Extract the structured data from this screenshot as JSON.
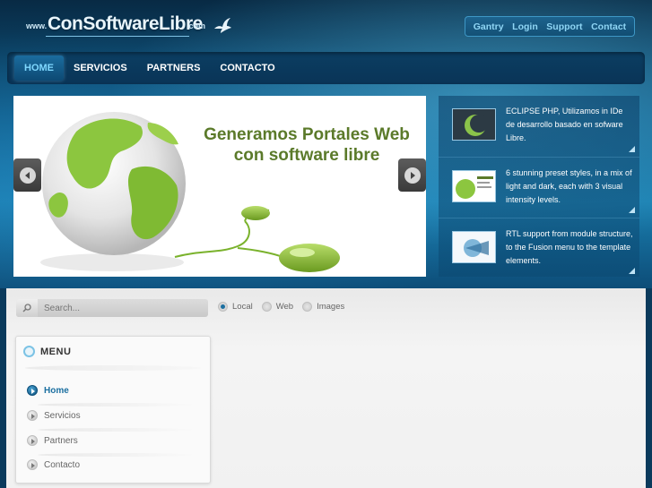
{
  "header": {
    "logo": {
      "prefix": "www.",
      "name": "ConSoftwareLibre",
      "suffix": ".com"
    },
    "top_links": [
      "Gantry",
      "Login",
      "Support",
      "Contact"
    ]
  },
  "main_nav": [
    {
      "label": "HOME",
      "active": true
    },
    {
      "label": "SERVICIOS",
      "active": false
    },
    {
      "label": "PARTNERS",
      "active": false
    },
    {
      "label": "CONTACTO",
      "active": false
    }
  ],
  "slider": {
    "headline_line1": "Generamos Portales Web",
    "headline_line2": "con software libre"
  },
  "side_panel": [
    {
      "text": "ECLIPSE PHP, Utilizamos in IDe de desarrollo basado en sofware Libre."
    },
    {
      "text": "6 stunning preset styles, in a mix of light and dark, each with 3 visual intensity levels."
    },
    {
      "text": "RTL support from module structure, to the Fusion menu to the template elements."
    }
  ],
  "search": {
    "placeholder": "Search...",
    "options": [
      {
        "label": "Local",
        "selected": true
      },
      {
        "label": "Web",
        "selected": false
      },
      {
        "label": "Images",
        "selected": false
      }
    ]
  },
  "menu": {
    "title": "MENU",
    "items": [
      {
        "label": "Home",
        "active": true
      },
      {
        "label": "Servicios",
        "active": false
      },
      {
        "label": "Partners",
        "active": false
      },
      {
        "label": "Contacto",
        "active": false
      }
    ]
  },
  "colors": {
    "accent": "#1b6fa0",
    "nav_active_text": "#7fd8ff",
    "slide_green": "#5b7a2a",
    "top_link": "#8fd6f5"
  }
}
